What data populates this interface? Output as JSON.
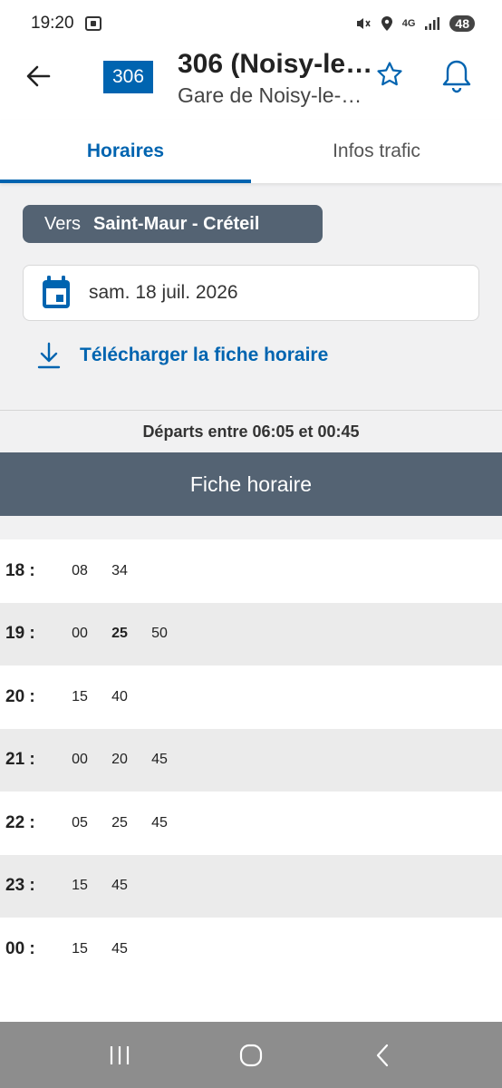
{
  "status": {
    "time": "19:20",
    "network": "4G",
    "battery": "48"
  },
  "header": {
    "line_number": "306",
    "title": "306 (Noisy-le…",
    "subtitle": "Gare de Noisy-le-…"
  },
  "tabs": [
    {
      "label": "Horaires",
      "active": true
    },
    {
      "label": "Infos trafic",
      "active": false
    }
  ],
  "direction": {
    "prefix": "Vers",
    "destination": "Saint-Maur - Créteil"
  },
  "date": {
    "value": "sam. 18 juil. 2026"
  },
  "download": {
    "label": "Télécharger la fiche horaire"
  },
  "departs_label": "Départs entre 06:05 et 00:45",
  "sheet_title": "Fiche horaire",
  "timetable": [
    {
      "hour": "18 :",
      "minutes": [
        "08",
        "34"
      ]
    },
    {
      "hour": "19 :",
      "minutes": [
        "00",
        "25",
        "50"
      ],
      "highlight": "25"
    },
    {
      "hour": "20 :",
      "minutes": [
        "15",
        "40"
      ]
    },
    {
      "hour": "21 :",
      "minutes": [
        "00",
        "20",
        "45"
      ]
    },
    {
      "hour": "22 :",
      "minutes": [
        "05",
        "25",
        "45"
      ]
    },
    {
      "hour": "23 :",
      "minutes": [
        "15",
        "45"
      ]
    },
    {
      "hour": "00 :",
      "minutes": [
        "15",
        "45"
      ]
    }
  ],
  "colors": {
    "primary_blue": "#0064b0",
    "slate": "#546373"
  }
}
